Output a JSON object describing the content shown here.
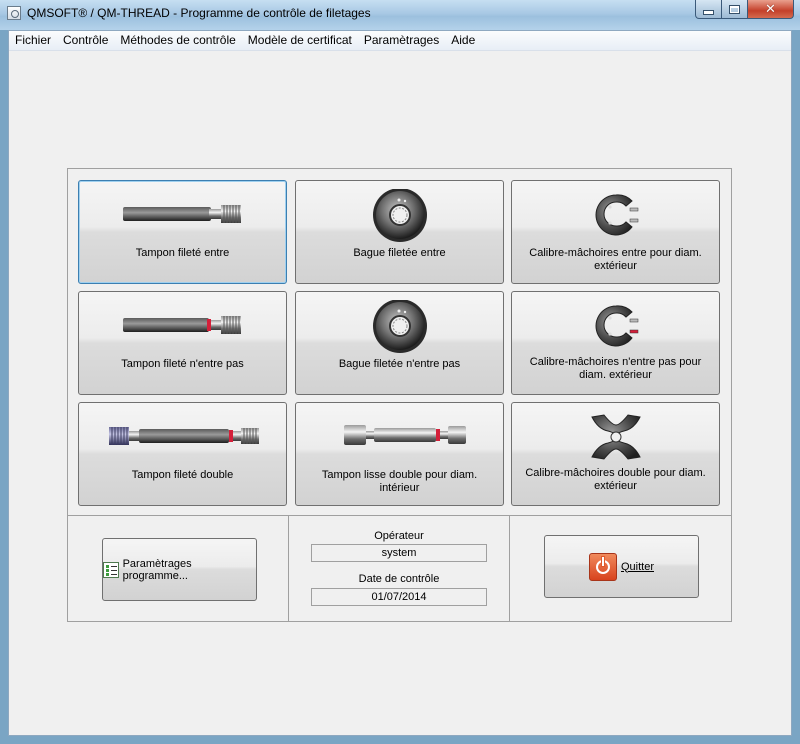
{
  "window": {
    "title": "QMSOFT® / QM-THREAD - Programme de contrôle de filetages"
  },
  "menu": [
    "Fichier",
    "Contrôle",
    "Méthodes de contrôle",
    "Modèle de certificat",
    "Paramètrages",
    "Aide"
  ],
  "gauges": [
    {
      "label": "Tampon fileté entre",
      "icon": "thread-plug-gauge-go-icon"
    },
    {
      "label": "Bague filetée entre",
      "icon": "thread-ring-gauge-go-icon"
    },
    {
      "label": "Calibre-mâchoires entre pour diam. extérieur",
      "icon": "snap-gauge-go-icon"
    },
    {
      "label": "Tampon fileté n'entre pas",
      "icon": "thread-plug-gauge-nogo-icon"
    },
    {
      "label": "Bague filetée n'entre pas",
      "icon": "thread-ring-gauge-nogo-icon"
    },
    {
      "label": "Calibre-mâchoires n'entre pas pour diam. extérieur",
      "icon": "snap-gauge-nogo-icon"
    },
    {
      "label": "Tampon fileté double",
      "icon": "double-thread-plug-gauge-icon"
    },
    {
      "label": "Tampon lisse double pour diam. intérieur",
      "icon": "double-plain-plug-gauge-icon"
    },
    {
      "label": "Calibre-mâchoires double pour diam. extérieur",
      "icon": "double-snap-gauge-icon"
    }
  ],
  "settings_button": {
    "label": "Paramètrages programme...",
    "icon": "checklist-icon"
  },
  "operator": {
    "label": "Opérateur",
    "value": "system"
  },
  "control_date": {
    "label": "Date de contrôle",
    "value": "01/07/2014"
  },
  "quit_button": {
    "label": "Quitter",
    "icon": "power-icon"
  },
  "colors": {
    "accent_red": "#d8431e",
    "focus_blue": "#3c7fb1"
  }
}
